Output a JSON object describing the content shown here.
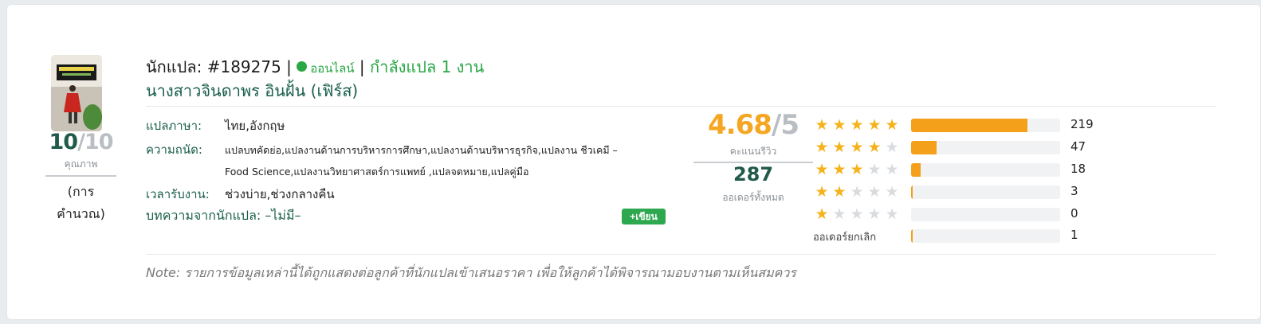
{
  "quality": {
    "score": "10",
    "max": "/10",
    "label": "คุณภาพ",
    "note_line1": "(การ",
    "note_line2": "คำนวณ)"
  },
  "header": {
    "translator": "นักแปล: #189275 |",
    "status": "ออนไลน์",
    "separator": "|",
    "working": "กำลังแปล 1 งาน",
    "name": "นางสาวจินดาพร อินฝั้น (เฟิร์ส)"
  },
  "info": {
    "languages_label": "แปลภาษา:",
    "languages_value": "ไทย,อังกฤษ",
    "skills_label": "ความถนัด:",
    "skills_value_line1": "แปลบทคัดย่อ,แปลงานด้านการบริหารการศึกษา,แปลงานด้านบริหารธุรกิจ,แปลงาน ชีวเคมี –",
    "skills_value_line2": "Food Science,แปลงานวิทยาศาสตร์การแพทย์ ,แปลจดหมาย,แปลคู่มือ",
    "time_label": "เวลารับงาน:",
    "time_value": "ช่วงบ่าย,ช่วงกลางคืน",
    "article": "บทความจากนักแปล: –ไม่มี–",
    "write_button": "+เขียน"
  },
  "rating": {
    "score": "4.68",
    "max": "/5",
    "score_label": "คะแนนรีวิว",
    "orders": "287",
    "orders_label": "ออเดอร์ทั้งหมด"
  },
  "breakdown": [
    {
      "stars": 5,
      "count": "219",
      "fill": 0.78
    },
    {
      "stars": 4,
      "count": "47",
      "fill": 0.17
    },
    {
      "stars": 3,
      "count": "18",
      "fill": 0.065
    },
    {
      "stars": 2,
      "count": "3",
      "fill": 0.012
    },
    {
      "stars": 1,
      "count": "0",
      "fill": 0
    }
  ],
  "cancelled": {
    "label": "ออเดอร์ยกเลิก",
    "count": "1",
    "fill": 0.004
  },
  "note": "Note: รายการข้อมูลเหล่านี้ได้ถูกแสดงต่อลูกค้าที่นักแปลเข้าเสนอราคา เพื่อให้ลูกค้าได้พิจารณามอบงานตามเห็นสมควร",
  "colors": {
    "brand_green": "#1a5f4c",
    "online_green": "#28a745",
    "star": "#f5b31b",
    "bar": "#f5a01a"
  }
}
